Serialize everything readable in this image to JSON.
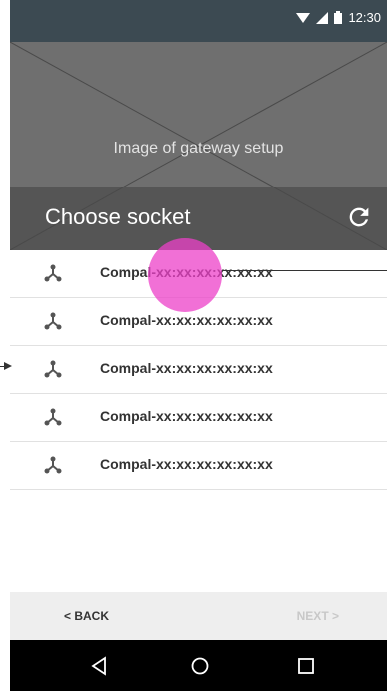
{
  "status_bar": {
    "time": "12:30"
  },
  "hero": {
    "caption": "Image of gateway setup"
  },
  "header": {
    "title": "Choose socket"
  },
  "sockets": [
    {
      "label": "Compal-xx:xx:xx:xx:xx:xx"
    },
    {
      "label": "Compal-xx:xx:xx:xx:xx:xx"
    },
    {
      "label": "Compal-xx:xx:xx:xx:xx:xx"
    },
    {
      "label": "Compal-xx:xx:xx:xx:xx:xx"
    },
    {
      "label": "Compal-xx:xx:xx:xx:xx:xx"
    }
  ],
  "footer": {
    "back_label": "< BACK",
    "next_label": "NEXT >"
  },
  "colors": {
    "status_bar": "#3c4a52",
    "header": "#555555",
    "touch_indicator": "#ec40c8"
  },
  "icons": [
    "wifi-icon",
    "signal-icon",
    "battery-icon",
    "refresh-icon",
    "network-icon",
    "back-triangle-icon",
    "home-circle-icon",
    "recents-square-icon"
  ]
}
